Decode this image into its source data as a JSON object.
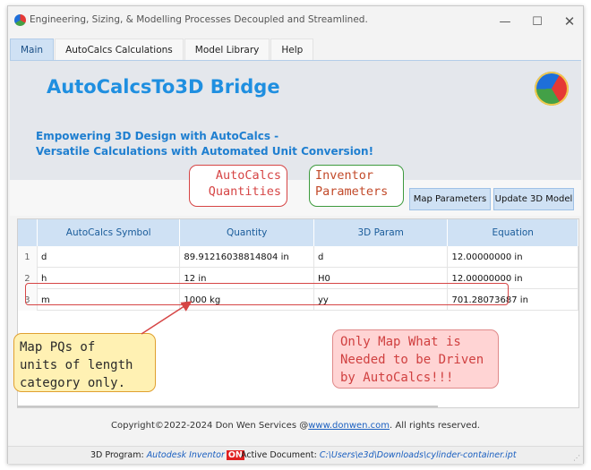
{
  "window": {
    "title": "Engineering, Sizing, & Modelling Processes Decoupled and Streamlined.",
    "icon": "app-logo-icon"
  },
  "tabs": [
    {
      "label": "Main",
      "active": true
    },
    {
      "label": "AutoCalcs Calculations",
      "active": false
    },
    {
      "label": "Model Library",
      "active": false
    },
    {
      "label": "Help",
      "active": false
    }
  ],
  "banner": {
    "title": "AutoCalcsTo3D Bridge",
    "subtitle_line1": "Empowering 3D Design with AutoCalcs -",
    "subtitle_line2": "Versatile Calculations with Automated Unit Conversion!",
    "accent_color": "#1f8fe0"
  },
  "toolbar": {
    "map_label": "Map Parameters",
    "update_label": "Update 3D Model"
  },
  "callouts": {
    "autocalcs_line1": "AutoCalcs",
    "autocalcs_line2": "Quantities",
    "inventor_line1": "Inventor",
    "inventor_line2": "Parameters",
    "map_line1": "Map PQs of",
    "map_line2": "units of length",
    "map_line3": "category only.",
    "only_line1": "Only Map What is",
    "only_line2": "Needed to be Driven",
    "only_line3": "by AutoCalcs!!!"
  },
  "table": {
    "columns": [
      "AutoCalcs Symbol",
      "Quantity",
      "3D Param",
      "Equation"
    ],
    "rows": [
      {
        "num": "1",
        "symbol": "d",
        "quantity": "89.91216038814804 in",
        "param": "d",
        "equation": "12.00000000 in"
      },
      {
        "num": "2",
        "symbol": "h",
        "quantity": "12 in",
        "param": "H0",
        "equation": "12.00000000 in"
      },
      {
        "num": "3",
        "symbol": "m",
        "quantity": "1000 kg",
        "param": "yy",
        "equation": "701.28073687 in"
      }
    ]
  },
  "footer": {
    "copyright_prefix": "Copyright©2022-2024 Don Wen Services @",
    "link": "www.donwen.com",
    "copyright_suffix": ". All rights reserved."
  },
  "status": {
    "program_label": "3D Program: ",
    "program_value": "Autodesk Inventor",
    "program_state": "ON",
    "doc_label": "Active Document: ",
    "doc_value": "C:\\Users\\e3d\\Downloads\\cylinder-container.ipt"
  }
}
